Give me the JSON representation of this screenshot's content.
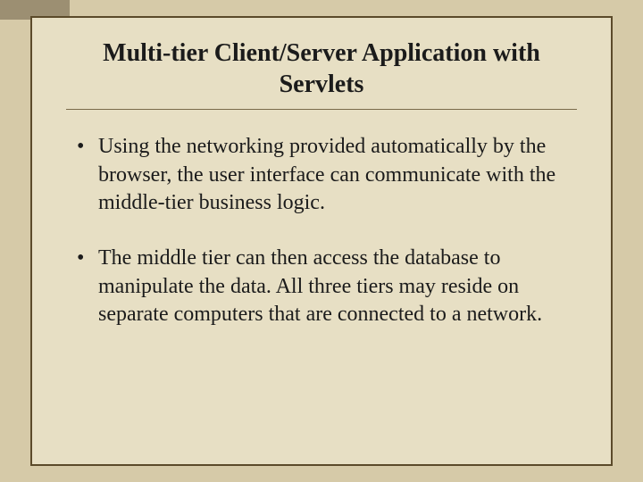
{
  "slide": {
    "title": "Multi-tier Client/Server Application with Servlets",
    "bullets": [
      "Using the networking provided automatically by the browser, the user interface can communicate with the middle-tier business logic.",
      "The middle tier can then access the database to manipulate the data. All three tiers may reside on separate computers that are connected to a network."
    ]
  }
}
